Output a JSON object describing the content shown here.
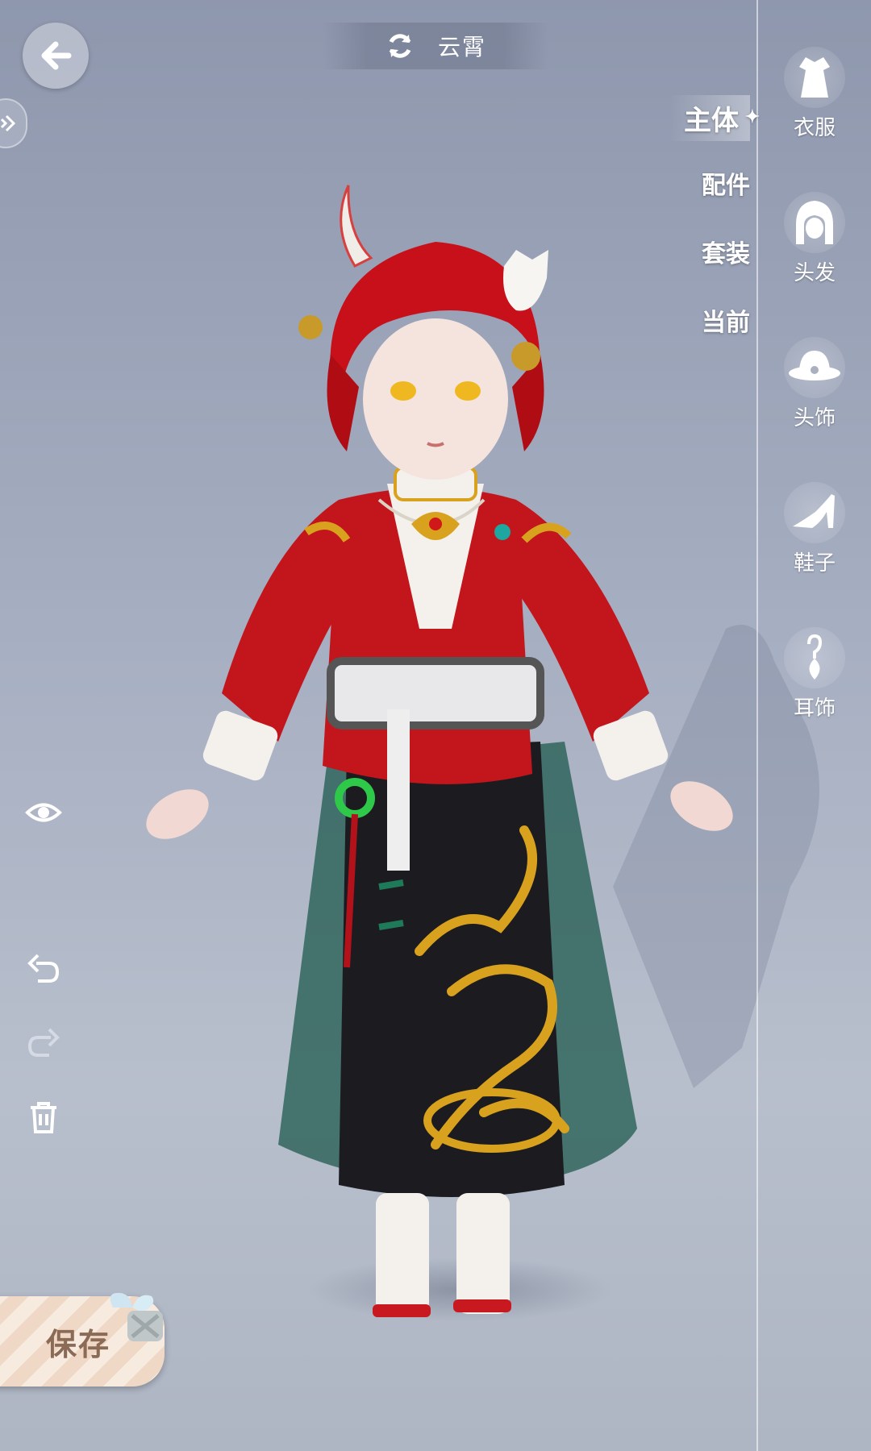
{
  "header": {
    "title": "云霄"
  },
  "category_tabs": [
    {
      "label": "主体",
      "active": true
    },
    {
      "label": "配件",
      "active": false
    },
    {
      "label": "套装",
      "active": false
    },
    {
      "label": "当前",
      "active": false
    }
  ],
  "right_rail": [
    {
      "label": "衣服",
      "icon": "dress-icon"
    },
    {
      "label": "头发",
      "icon": "hair-icon"
    },
    {
      "label": "头饰",
      "icon": "hat-icon"
    },
    {
      "label": "鞋子",
      "icon": "shoe-icon"
    },
    {
      "label": "耳饰",
      "icon": "earring-icon"
    }
  ],
  "left_tools": [
    "eye-icon",
    "undo-icon",
    "redo-icon",
    "trash-icon"
  ],
  "save": {
    "label": "保存"
  },
  "colors": {
    "background": "#9ea6ba",
    "robe_red": "#c3161c",
    "skirt_black": "#1c1c20",
    "gold": "#d9a21e",
    "veil_green": "#1f5a4e",
    "hair_red": "#c8101a"
  }
}
